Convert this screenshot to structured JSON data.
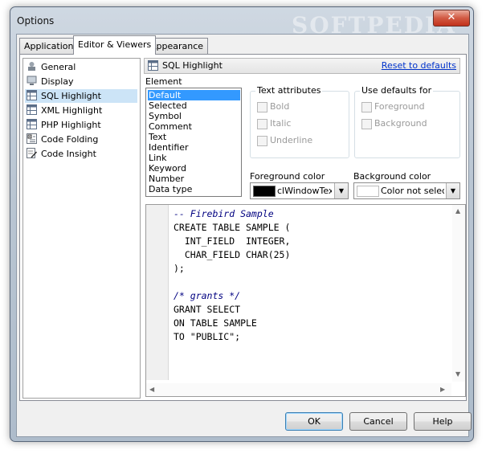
{
  "window": {
    "title": "Options",
    "watermark": "SOFTPEDIA"
  },
  "tabs": [
    {
      "label": "Application",
      "active": false
    },
    {
      "label": "Editor & Viewers",
      "active": true
    },
    {
      "label": "Appearance",
      "active": false
    }
  ],
  "nav": {
    "items": [
      {
        "label": "General",
        "icon": "general-icon",
        "selected": false
      },
      {
        "label": "Display",
        "icon": "display-icon",
        "selected": false
      },
      {
        "label": "SQL Highlight",
        "icon": "grid-icon",
        "selected": true
      },
      {
        "label": "XML Highlight",
        "icon": "grid-icon",
        "selected": false
      },
      {
        "label": "PHP Highlight",
        "icon": "grid-icon",
        "selected": false
      },
      {
        "label": "Code Folding",
        "icon": "folding-icon",
        "selected": false
      },
      {
        "label": "Code Insight",
        "icon": "insight-icon",
        "selected": false
      }
    ]
  },
  "panel": {
    "title": "SQL Highlight",
    "reset_label": "Reset to defaults",
    "element_label": "Element",
    "elements": [
      "Default",
      "Selected",
      "Symbol",
      "Comment",
      "Text",
      "Identifier",
      "Link",
      "Keyword",
      "Number",
      "Data type"
    ],
    "selected_element": "Default",
    "text_attributes": {
      "label": "Text attributes",
      "options": [
        {
          "label": "Bold",
          "checked": false
        },
        {
          "label": "Italic",
          "checked": false
        },
        {
          "label": "Underline",
          "checked": false
        }
      ]
    },
    "use_defaults": {
      "label": "Use defaults for",
      "options": [
        {
          "label": "Foreground",
          "checked": false
        },
        {
          "label": "Background",
          "checked": false
        }
      ]
    },
    "foreground": {
      "label": "Foreground color",
      "value": "clWindowText",
      "swatch": "#000000"
    },
    "background": {
      "label": "Background color",
      "value": "Color not selected",
      "swatch": "#ffffff"
    }
  },
  "code_lines": [
    {
      "text": "-- Firebird Sample",
      "style": "cmt"
    },
    {
      "text": "CREATE TABLE SAMPLE (",
      "style": "kw"
    },
    {
      "text": "  INT_FIELD  INTEGER,",
      "style": "kw"
    },
    {
      "text": "  CHAR_FIELD CHAR(25)",
      "style": "kw"
    },
    {
      "text": ");",
      "style": "kw"
    },
    {
      "text": "",
      "style": "kw"
    },
    {
      "text": "/* grants */",
      "style": "cmt"
    },
    {
      "text": "GRANT SELECT",
      "style": "kw"
    },
    {
      "text": "ON TABLE SAMPLE",
      "style": "kw"
    },
    {
      "text": "TO \"PUBLIC\";",
      "style": "kw"
    }
  ],
  "buttons": {
    "ok": "OK",
    "cancel": "Cancel",
    "help": "Help"
  }
}
